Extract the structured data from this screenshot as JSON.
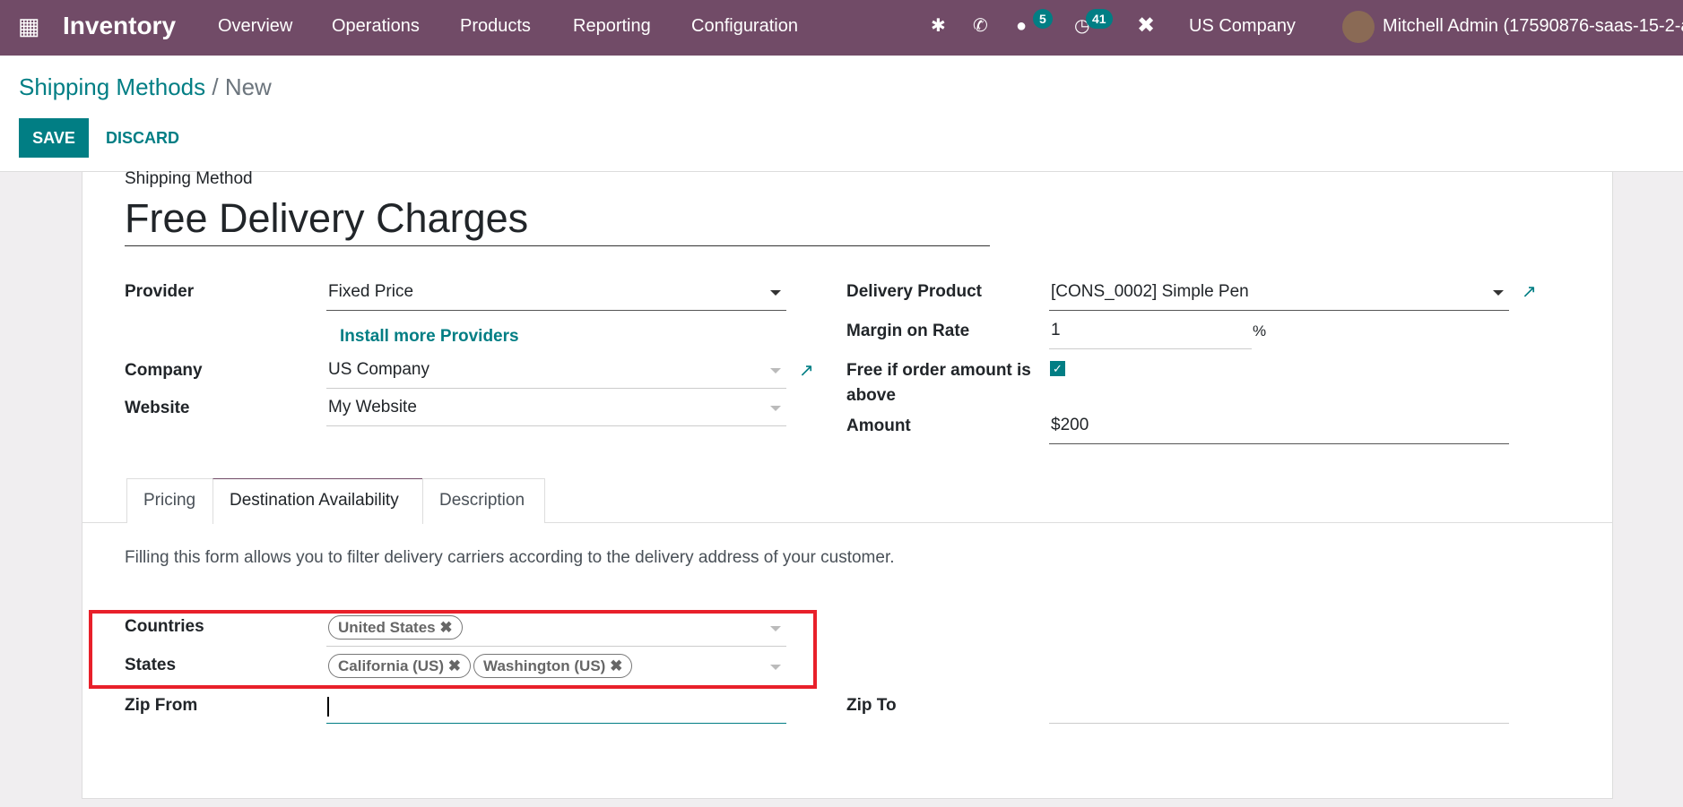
{
  "navbar": {
    "app": "Inventory",
    "menus": [
      "Overview",
      "Operations",
      "Products",
      "Reporting",
      "Configuration"
    ],
    "messages_count": "5",
    "activities_count": "41",
    "company": "US Company",
    "user": "Mitchell Admin (17590876-saas-15-2-a"
  },
  "breadcrumb": {
    "parent": "Shipping Methods",
    "sep": " / ",
    "current": "New"
  },
  "buttons": {
    "save": "SAVE",
    "discard": "DISCARD"
  },
  "form": {
    "title_label": "Shipping Method",
    "title": "Free Delivery Charges",
    "provider_label": "Provider",
    "provider": "Fixed Price",
    "install_link": "Install more Providers",
    "company_label": "Company",
    "company": "US Company",
    "website_label": "Website",
    "website": "My Website",
    "delivery_product_label": "Delivery Product",
    "delivery_product": "[CONS_0002] Simple Pen",
    "margin_label": "Margin on Rate",
    "margin": "1",
    "margin_unit": "%",
    "free_label_1": "Free if order amount is",
    "free_label_2": "above",
    "free_checked": true,
    "amount_label": "Amount",
    "amount": "$200"
  },
  "tabs": [
    "Pricing",
    "Destination Availability",
    "Description"
  ],
  "active_tab": "Destination Availability",
  "destination": {
    "help": "Filling this form allows you to filter delivery carriers according to the delivery address of your customer.",
    "countries_label": "Countries",
    "countries": [
      "United States"
    ],
    "states_label": "States",
    "states": [
      "California (US)",
      "Washington (US)"
    ],
    "zip_from_label": "Zip From",
    "zip_from": "",
    "zip_to_label": "Zip To",
    "zip_to": ""
  },
  "colors": {
    "navbar": "#714b67",
    "primary": "#017e84",
    "highlight": "#e8202a"
  }
}
